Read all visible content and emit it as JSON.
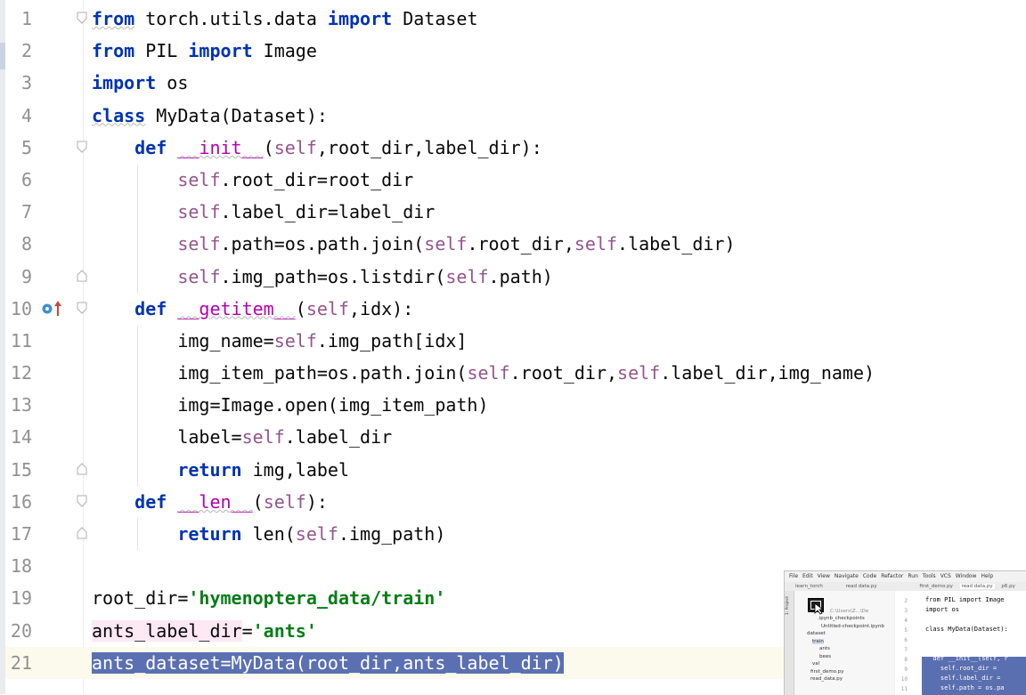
{
  "editor": {
    "lines": [
      {
        "n": "1",
        "segs": [
          {
            "t": "from",
            "c": "kw",
            "w": "wavy"
          },
          {
            "t": " torch.utils.data "
          },
          {
            "t": "import",
            "c": "kw"
          },
          {
            "t": " Dataset"
          }
        ]
      },
      {
        "n": "2",
        "segs": [
          {
            "t": "from",
            "c": "kw"
          },
          {
            "t": " PIL "
          },
          {
            "t": "import",
            "c": "kw"
          },
          {
            "t": " Image"
          }
        ]
      },
      {
        "n": "3",
        "segs": [
          {
            "t": "import",
            "c": "kw"
          },
          {
            "t": " os"
          }
        ]
      },
      {
        "n": "4",
        "segs": [
          {
            "t": "class",
            "c": "kw",
            "w": "wavy"
          },
          {
            "t": " MyData(Dataset):"
          }
        ]
      },
      {
        "n": "5",
        "segs": [
          {
            "t": "    "
          },
          {
            "t": "def",
            "c": "kw"
          },
          {
            "t": " "
          },
          {
            "t": "__init__",
            "c": "mg",
            "w": "wavy"
          },
          {
            "t": "("
          },
          {
            "t": "self",
            "c": "self"
          },
          {
            "t": ",root_dir,label_dir):"
          }
        ]
      },
      {
        "n": "6",
        "segs": [
          {
            "t": "        "
          },
          {
            "t": "self",
            "c": "self"
          },
          {
            "t": ".root_dir=root_dir"
          }
        ]
      },
      {
        "n": "7",
        "segs": [
          {
            "t": "        "
          },
          {
            "t": "self",
            "c": "self"
          },
          {
            "t": ".label_dir=label_dir"
          }
        ]
      },
      {
        "n": "8",
        "segs": [
          {
            "t": "        "
          },
          {
            "t": "self",
            "c": "self"
          },
          {
            "t": ".path=os.path.join("
          },
          {
            "t": "self",
            "c": "self"
          },
          {
            "t": ".root_dir,"
          },
          {
            "t": "self",
            "c": "self"
          },
          {
            "t": ".label_dir)"
          }
        ]
      },
      {
        "n": "9",
        "segs": [
          {
            "t": "        "
          },
          {
            "t": "self",
            "c": "self"
          },
          {
            "t": ".img_path=os.listdir("
          },
          {
            "t": "self",
            "c": "self"
          },
          {
            "t": ".path)"
          }
        ]
      },
      {
        "n": "10",
        "segs": [
          {
            "t": "    "
          },
          {
            "t": "def",
            "c": "kw"
          },
          {
            "t": " "
          },
          {
            "t": "__getitem__",
            "c": "mg",
            "w": "wavy"
          },
          {
            "t": "("
          },
          {
            "t": "self",
            "c": "self"
          },
          {
            "t": ",idx):"
          }
        ]
      },
      {
        "n": "11",
        "segs": [
          {
            "t": "        img_name="
          },
          {
            "t": "self",
            "c": "self"
          },
          {
            "t": ".img_path[idx]"
          }
        ]
      },
      {
        "n": "12",
        "segs": [
          {
            "t": "        img_item_path=os.path.join("
          },
          {
            "t": "self",
            "c": "self"
          },
          {
            "t": ".root_dir,"
          },
          {
            "t": "self",
            "c": "self"
          },
          {
            "t": ".label_dir,img_name)"
          }
        ]
      },
      {
        "n": "13",
        "segs": [
          {
            "t": "        img=Image.open(img_item_path)"
          }
        ]
      },
      {
        "n": "14",
        "segs": [
          {
            "t": "        label="
          },
          {
            "t": "self",
            "c": "self"
          },
          {
            "t": ".label_dir"
          }
        ]
      },
      {
        "n": "15",
        "segs": [
          {
            "t": "        "
          },
          {
            "t": "return",
            "c": "kw"
          },
          {
            "t": " img,label"
          }
        ]
      },
      {
        "n": "16",
        "segs": [
          {
            "t": "    "
          },
          {
            "t": "def",
            "c": "kw"
          },
          {
            "t": " "
          },
          {
            "t": "__len__",
            "c": "mg",
            "w": "wavy"
          },
          {
            "t": "("
          },
          {
            "t": "self",
            "c": "self"
          },
          {
            "t": "):"
          }
        ]
      },
      {
        "n": "17",
        "segs": [
          {
            "t": "        "
          },
          {
            "t": "return",
            "c": "kw"
          },
          {
            "t": " len("
          },
          {
            "t": "self",
            "c": "self"
          },
          {
            "t": ".img_path)"
          }
        ]
      },
      {
        "n": "18",
        "segs": []
      },
      {
        "n": "19",
        "segs": [
          {
            "t": "root_dir="
          },
          {
            "t": "'hymenoptera_data/train'",
            "c": "str"
          }
        ]
      },
      {
        "n": "20",
        "segs": [
          {
            "t": "ants_label_dir",
            "c": "hl-pink"
          },
          {
            "t": "="
          },
          {
            "t": "'ants'",
            "c": "str"
          }
        ]
      },
      {
        "n": "21",
        "current": true,
        "segs": [
          {
            "t": "ants_dataset=MyData(root_dir,ants_label_dir)",
            "c": "sel"
          }
        ]
      }
    ]
  },
  "thumbnail": {
    "menu": [
      "File",
      "Edit",
      "View",
      "Navigate",
      "Code",
      "Refactor",
      "Run",
      "Tools",
      "VCS",
      "Window",
      "Help"
    ],
    "crumb": "learn_torch",
    "file_crumb": "read data.py",
    "tabs": [
      "first_demo.py",
      "read data.py",
      "p6.py"
    ],
    "tree": [
      ".ipynb_checkpoints",
      "Untitled-checkpoint.ipynb",
      "dataset",
      "train",
      "ants",
      "bees",
      "val",
      "first_demo.py",
      "read_data.py"
    ],
    "path_hint": "C:\\Users\\Z...\\De",
    "side_label": "1: Project",
    "code": [
      {
        "n": "2",
        "t": "from PIL import Image"
      },
      {
        "n": "3",
        "t": "import os"
      },
      {
        "n": "4",
        "t": ""
      },
      {
        "n": "5",
        "t": "class MyData(Dataset):"
      },
      {
        "n": "6",
        "t": ""
      },
      {
        "n": "7",
        "t": ""
      },
      {
        "n": "8",
        "t": "  def __init__(self, r"
      },
      {
        "n": "9",
        "t": "    self.root_dir = "
      },
      {
        "n": "10",
        "t": "    self.label_dir = "
      },
      {
        "n": "11",
        "t": "    self.path = os.pa"
      }
    ]
  },
  "colors": {
    "keyword": "#0033b3",
    "self": "#94558d",
    "magic": "#b200b2",
    "string": "#067d17",
    "selection": "#5b70b2"
  }
}
